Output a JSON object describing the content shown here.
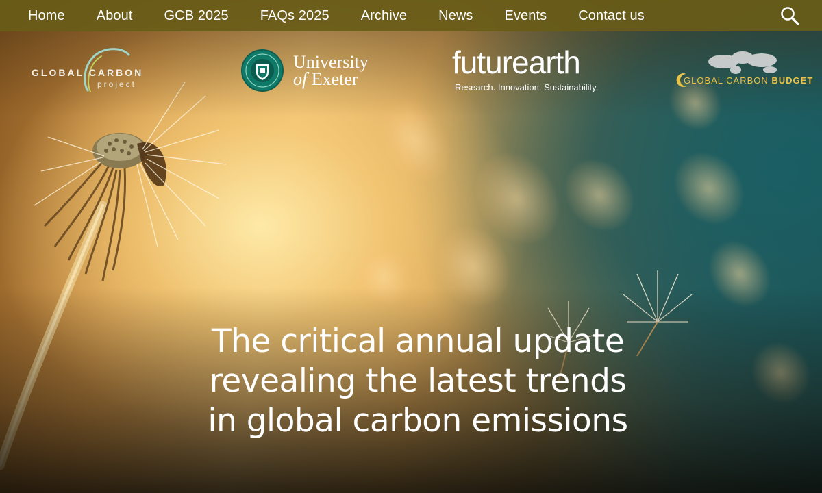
{
  "nav": {
    "items": [
      "Home",
      "About",
      "GCB 2025",
      "FAQs 2025",
      "Archive",
      "News",
      "Events",
      "Contact us"
    ],
    "search_icon": "search-icon"
  },
  "logos": {
    "global_carbon_project": {
      "line1": "GLOBAL CARBON",
      "line2": "project"
    },
    "university_of_exeter": {
      "line1": "University",
      "line2_prefix": "of",
      "line2_rest": " Exeter"
    },
    "future_earth": {
      "wordmark": "futurearth",
      "tagline": "Research. Innovation. Sustainability."
    },
    "global_carbon_budget": {
      "part1": "GLOBAL CARBON ",
      "part2": "BUDGET"
    }
  },
  "hero": {
    "headline": [
      "The critical annual update",
      "revealing the latest trends",
      "in global carbon emissions"
    ]
  },
  "colors": {
    "nav_bg": "#695c18",
    "text": "#ffffff",
    "gcb_gold": "#e9c24a",
    "exeter_green": "#0f7a68"
  }
}
